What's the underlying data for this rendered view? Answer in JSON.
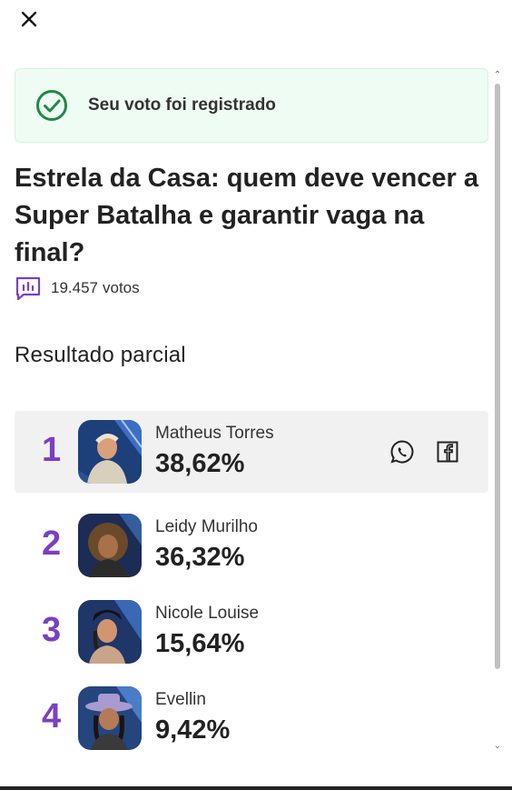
{
  "close": {
    "icon": "close-icon"
  },
  "banner": {
    "message": "Seu voto foi registrado",
    "icon": "check-circle-icon",
    "accent": "#1f8a45"
  },
  "poll": {
    "question": "Estrela da Casa: quem deve vencer a Super Batalha e garantir vaga na final?",
    "votes_count": "19.457",
    "votes_label": "votos",
    "votes_icon": "poll-chart-icon"
  },
  "results": {
    "title": "Resultado parcial",
    "items": [
      {
        "rank": "1",
        "name": "Matheus Torres",
        "percent": "38,62%",
        "value": 38.62
      },
      {
        "rank": "2",
        "name": "Leidy Murilho",
        "percent": "36,32%",
        "value": 36.32
      },
      {
        "rank": "3",
        "name": "Nicole Louise",
        "percent": "15,64%",
        "value": 15.64
      },
      {
        "rank": "4",
        "name": "Evellin",
        "percent": "9,42%",
        "value": 9.42
      }
    ]
  },
  "share": {
    "whatsapp_icon": "whatsapp-icon",
    "facebook_icon": "facebook-icon"
  },
  "colors": {
    "rank": "#7b3fc4",
    "highlight": "#f1f1f1",
    "banner_bg": "#effcf3"
  }
}
